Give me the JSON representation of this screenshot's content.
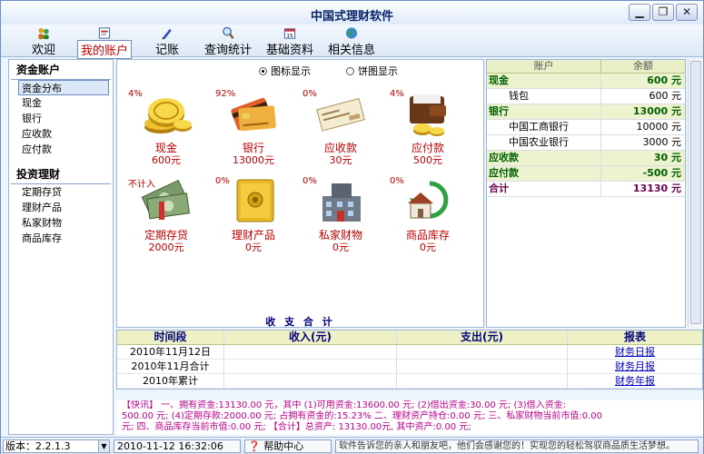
{
  "window": {
    "title": "中国式理财软件"
  },
  "toolbar": {
    "items": [
      {
        "label": "欢迎",
        "icon": "people-icon"
      },
      {
        "label": "我的账户",
        "icon": "ledger-icon",
        "active": true
      },
      {
        "label": "记账",
        "icon": "pen-icon"
      },
      {
        "label": "查询统计",
        "icon": "magnifier-icon"
      },
      {
        "label": "基础资料",
        "icon": "calendar-icon"
      },
      {
        "label": "相关信息",
        "icon": "globe-icon"
      }
    ]
  },
  "sidebar": {
    "section1": {
      "title": "资金账户",
      "items": [
        "资金分布",
        "现金",
        "银行",
        "应收款",
        "应付款"
      ]
    },
    "section2": {
      "title": "投资理财",
      "items": [
        "定期存贷",
        "理财产品",
        "私家财物",
        "商品库存"
      ]
    },
    "selected": "资金分布"
  },
  "view_options": {
    "icon_view": "图标显示",
    "pie_view": "饼图显示",
    "selected": "icon"
  },
  "accounts": [
    {
      "name": "现金",
      "amount": "600元",
      "pct": "4%",
      "icon": "coins-icon"
    },
    {
      "name": "银行",
      "amount": "13000元",
      "pct": "92%",
      "icon": "bank-cards-icon"
    },
    {
      "name": "应收款",
      "amount": "30元",
      "pct": "0%",
      "icon": "cheque-icon"
    },
    {
      "name": "应付款",
      "amount": "500元",
      "pct": "4%",
      "icon": "wallet-icon"
    },
    {
      "name": "定期存贷",
      "amount": "2000元",
      "pct": "不计入",
      "icon": "banknotes-icon"
    },
    {
      "name": "理财产品",
      "amount": "0元",
      "pct": "0%",
      "icon": "safe-icon"
    },
    {
      "name": "私家财物",
      "amount": "0元",
      "pct": "0%",
      "icon": "building-icon"
    },
    {
      "name": "商品库存",
      "amount": "0元",
      "pct": "0%",
      "icon": "house-recycle-icon"
    }
  ],
  "balance_table": {
    "headers": [
      "账户",
      "余额"
    ],
    "rows": [
      {
        "name": "现金",
        "amount": "600 元",
        "kind": "grp"
      },
      {
        "name": "钱包",
        "amount": "600 元",
        "kind": "sub"
      },
      {
        "name": "银行",
        "amount": "13000 元",
        "kind": "grp"
      },
      {
        "name": "中国工商银行",
        "amount": "10000 元",
        "kind": "sub"
      },
      {
        "name": "中国农业银行",
        "amount": "3000 元",
        "kind": "sub"
      },
      {
        "name": "应收款",
        "amount": "30 元",
        "kind": "grp"
      },
      {
        "name": "应付款",
        "amount": "-500 元",
        "kind": "grp"
      },
      {
        "name": "合计",
        "amount": "13130 元",
        "kind": "total"
      }
    ]
  },
  "summary": {
    "title": "收 支 合 计",
    "headers": [
      "时间段",
      "收入(元)",
      "支出(元)",
      "报表"
    ],
    "rows": [
      {
        "period": "2010年11月12日",
        "income": "",
        "expense": "",
        "report": "财务日报"
      },
      {
        "period": "2010年11月合计",
        "income": "",
        "expense": "",
        "report": "财务月报"
      },
      {
        "period": "2010年累计",
        "income": "",
        "expense": "",
        "report": "财务年报"
      }
    ]
  },
  "quick_report": {
    "line1": "【快讯】  一、拥有资金:13130.00 元，其中 (1)可用资金:13600.00 元; (2)借出资金:30.00 元; (3)借入资金:",
    "line2": "500.00 元; (4)定期存款:2000.00 元; 占拥有资金的:15.23%  二、理财资产持仓:0.00 元;    三、私家财物当前市值:0.00",
    "line3": "元;   四、商品库存当前市值:0.00 元;    【合计】总资产: 13130.00元,  其中资产:0.00 元;"
  },
  "statusbar": {
    "version": "版本：2.2.1.3",
    "datetime": "2010-11-12  16:32:06",
    "help": "帮助中心",
    "message": "软件告诉您的亲人和朋友吧，他们会感谢您的！实现您的轻松驾驭商品质生活梦想。"
  },
  "colors": {
    "accent_red": "#c00000",
    "header_blue": "#000080",
    "group_green": "#006000"
  }
}
